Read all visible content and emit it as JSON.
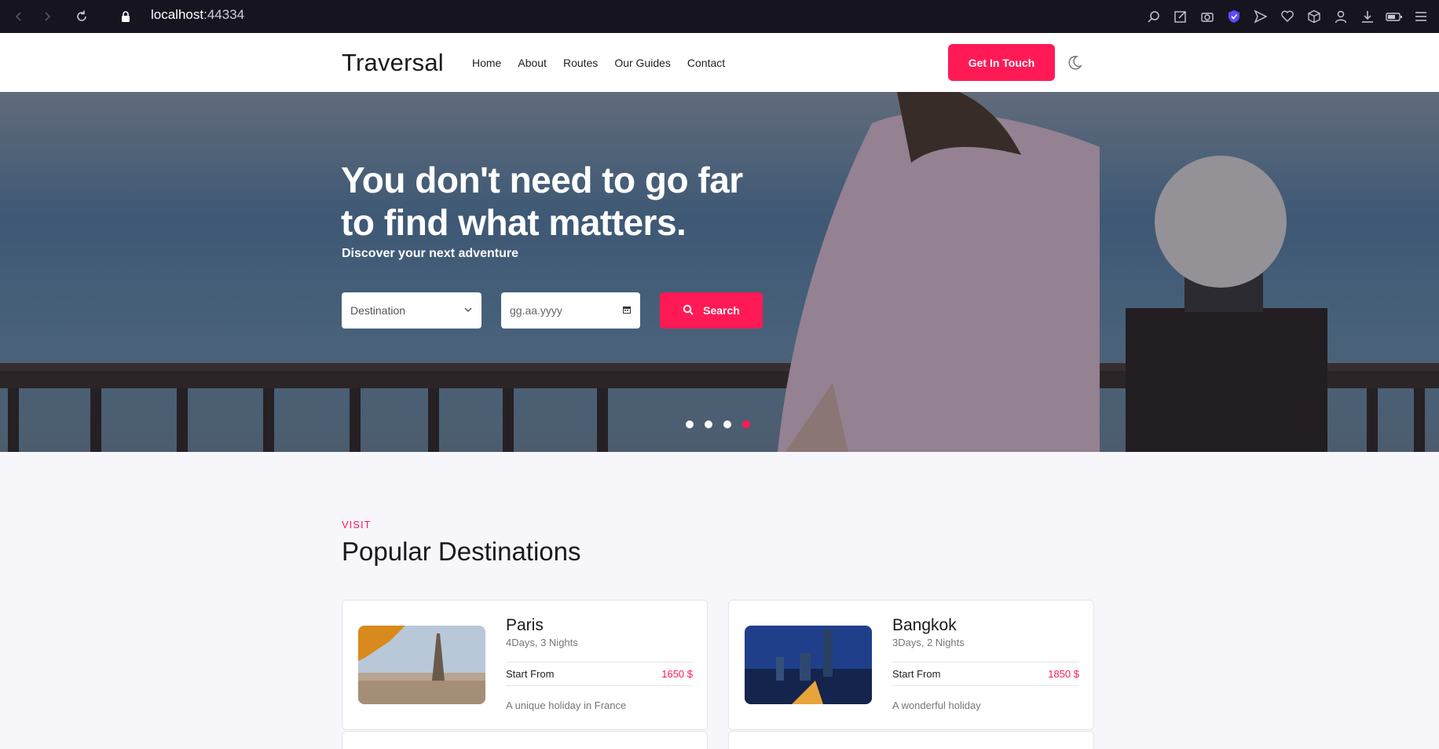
{
  "browser": {
    "url_host": "localhost",
    "url_port": ":44334"
  },
  "nav": {
    "brand": "Traversal",
    "links": [
      "Home",
      "About",
      "Routes",
      "Our Guides",
      "Contact"
    ],
    "cta": "Get In Touch"
  },
  "hero": {
    "title": "You don't need to go far to find what matters.",
    "subtitle": "Discover your next adventure",
    "destination_placeholder": "Destination",
    "date_placeholder": "gg.aa.yyyy",
    "search_label": "Search",
    "slides": 4,
    "active_slide": 4
  },
  "destinations": {
    "eyebrow": "VISIT",
    "title": "Popular Destinations",
    "items": [
      {
        "name": "Paris",
        "duration": "4Days, 3 Nights",
        "start_label": "Start From",
        "price": "1650 $",
        "description": "A unique holiday in France"
      },
      {
        "name": "Bangkok",
        "duration": "3Days, 2 Nights",
        "start_label": "Start From",
        "price": "1850 $",
        "description": "A wonderful holiday"
      }
    ]
  },
  "colors": {
    "accent": "#ff1a56",
    "chrome": "#16151f",
    "background": "#f7f7fb"
  },
  "icons": {
    "browser": [
      "back-icon",
      "forward-icon",
      "reload-icon",
      "lock-icon"
    ],
    "toolbar": [
      "search-icon",
      "edit-icon",
      "camera-icon",
      "shield-icon",
      "send-icon",
      "heart-icon",
      "cube-icon",
      "user-icon",
      "download-icon",
      "battery-icon",
      "menu-icon"
    ]
  }
}
